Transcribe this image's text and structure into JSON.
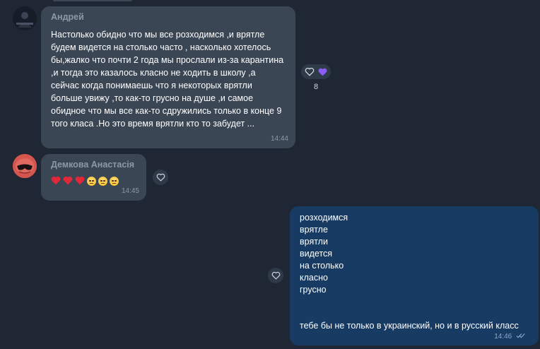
{
  "messages": [
    {
      "sender": "Андрей",
      "text": "Настолько обидно что мы все розходимся ,и врятле будем видется на столько часто , насколько хотелось бы,жалко что почти 2 года мы прослали из-за карантина ,и тогда это казалось класно не ходить в школу ,а сейчас когда понимаешь что я некоторых врятли больше увижу ,то как-то грусно на душе ,и самое обидное что мы все как-то сдружились только в конце 9 того класа .Но это время врятли кто то забудет ...",
      "time": "14:44",
      "reaction_count": "8"
    },
    {
      "sender": "Демкова Анастасія",
      "time": "14:45",
      "emoji": [
        "red-heart",
        "red-heart",
        "red-heart",
        "unamused-face",
        "unamused-face",
        "unamused-face"
      ]
    },
    {
      "lines": [
        "розходимся",
        "врятле",
        "врятли",
        "видется",
        "на столько",
        "класно",
        "грусно"
      ],
      "footer": "тебе бы не только в украинский, но и в русский класс",
      "time": "14:46",
      "status": "read"
    }
  ],
  "colors": {
    "background": "#1e2733",
    "incoming_bubble": "#3b4655",
    "outgoing_bubble": "#173b63",
    "sender_name": "#8a98a8",
    "heart": "#e0283a",
    "purple_heart": "#8b5cf6"
  },
  "icons": [
    "heart-outline-icon",
    "purple-heart-icon",
    "red-heart-icon",
    "unamused-face-icon",
    "double-check-icon"
  ]
}
